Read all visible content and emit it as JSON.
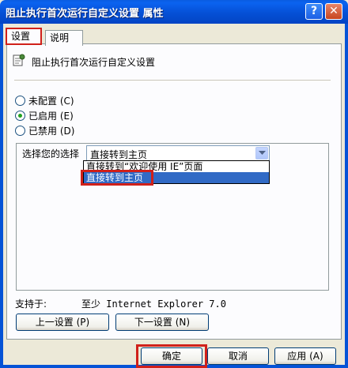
{
  "window": {
    "title": "阻止执行首次运行自定义设置 属性",
    "help_label": "?",
    "close_label": "✕"
  },
  "tabs": [
    {
      "label": "设置"
    },
    {
      "label": "说明"
    }
  ],
  "policy": {
    "name": "阻止执行首次运行自定义设置",
    "icon": "policy-settings-icon"
  },
  "radios": [
    {
      "label": "未配置 (C)",
      "checked": false
    },
    {
      "label": "已启用 (E)",
      "checked": true
    },
    {
      "label": "已禁用 (D)",
      "checked": false
    }
  ],
  "options": {
    "select_label": "选择您的选择",
    "select_value": "直接转到主页",
    "dropdown_items": [
      "直接转到“欢迎使用 IE”页面",
      "直接转到主页"
    ]
  },
  "supported": {
    "label": "支持于:",
    "value": "至少 Internet Explorer 7.0"
  },
  "buttons": {
    "prev": "上一设置 (P)",
    "next": "下一设置 (N)",
    "ok": "确定",
    "cancel": "取消",
    "apply": "应用 (A)"
  },
  "colors": {
    "titlebar": "#0553d6",
    "highlight": "#d0201a",
    "selection": "#316ac5"
  }
}
